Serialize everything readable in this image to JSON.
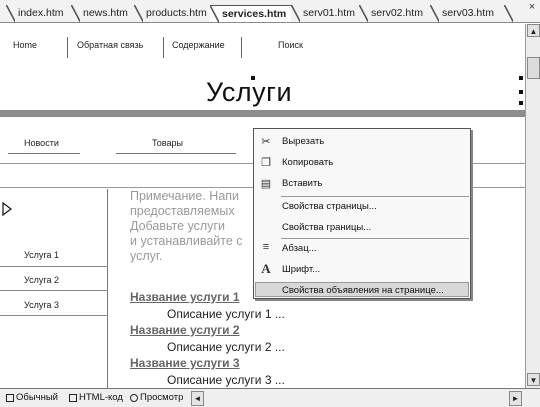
{
  "tabs": [
    {
      "label": "index.htm",
      "active": false
    },
    {
      "label": "news.htm",
      "active": false
    },
    {
      "label": "products.htm",
      "active": false
    },
    {
      "label": "services.htm",
      "active": true
    },
    {
      "label": "serv01.htm",
      "active": false
    },
    {
      "label": "serv02.htm",
      "active": false
    },
    {
      "label": "serv03.htm",
      "active": false
    }
  ],
  "tabbar": {
    "close": "×",
    "nav_prev": "◄",
    "nav_next": "►"
  },
  "page": {
    "topnav": [
      "Home",
      "Обратная связь",
      "Содержание",
      "Поиск"
    ],
    "title": "Услуги",
    "secnav": [
      "Новости",
      "Товары"
    ],
    "sidebar": [
      "Услуга 1",
      "Услуга 2",
      "Услуга 3"
    ],
    "note_lines": [
      "Примечание. Напи",
      "предоставляемых",
      "Добавьте услуги",
      "и устанавливайте с",
      "услуг."
    ],
    "services": [
      {
        "name": "Название услуги 1",
        "desc": "Описание услуги 1 ..."
      },
      {
        "name": "Название услуги 2",
        "desc": "Описание услуги 2 ..."
      },
      {
        "name": "Название услуги 3",
        "desc": "Описание услуги 3 ..."
      }
    ]
  },
  "context_menu": {
    "items": [
      {
        "label": "Вырезать",
        "icon": "scissors-icon"
      },
      {
        "label": "Копировать",
        "icon": "copy-icon"
      },
      {
        "label": "Вставить",
        "icon": "paste-icon"
      },
      {
        "label": "Свойства страницы...",
        "icon": ""
      },
      {
        "label": "Свойства границы...",
        "icon": ""
      },
      {
        "label": "Абзац...",
        "icon": "paragraph-icon"
      },
      {
        "label": "Шрифт...",
        "icon": "font-icon"
      },
      {
        "label": "Свойства объявления на странице...",
        "icon": ""
      }
    ],
    "highlighted": 7
  },
  "views": [
    {
      "label": "Обычный"
    },
    {
      "label": "HTML-код"
    },
    {
      "label": "Просмотр"
    }
  ],
  "scroll": {
    "up": "▲",
    "down": "▼",
    "left": "◄",
    "right": "►"
  }
}
